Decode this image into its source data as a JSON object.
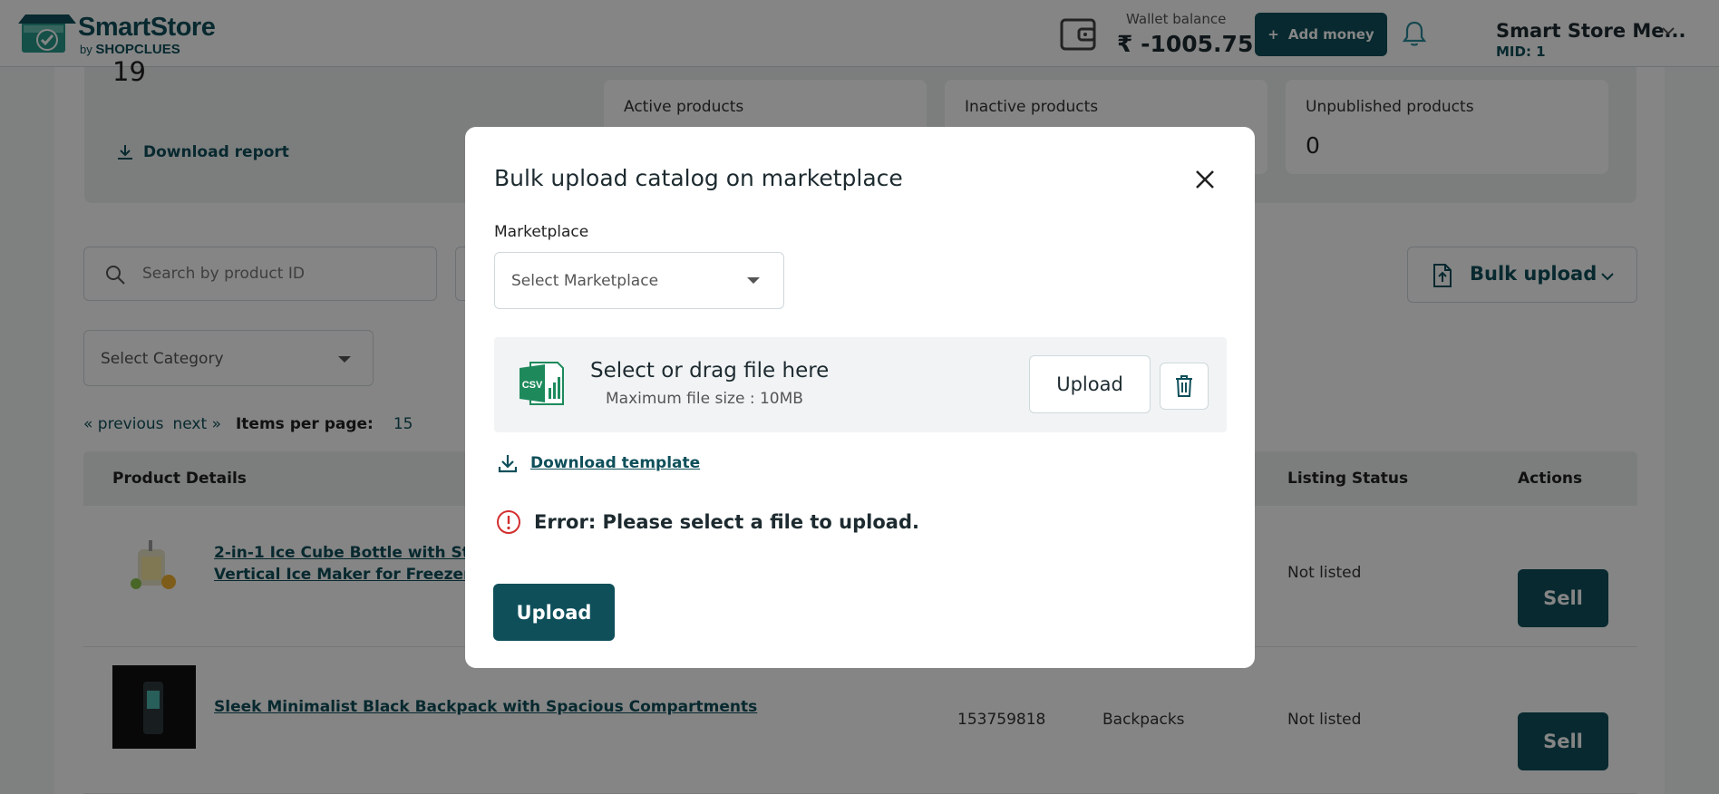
{
  "header": {
    "logo_title": "SmartStore",
    "logo_by": "by",
    "logo_brand": "SHOPCLUES",
    "wallet_label": "Wallet balance",
    "wallet_amount": "₹ -1005.75",
    "add_money_label": "Add money",
    "account_name": "Smart Store Me...",
    "account_mid": "MID: 1"
  },
  "summary": {
    "count_value": "19",
    "download_report_label": "Download report",
    "stats": [
      {
        "label": "Active products",
        "value": ""
      },
      {
        "label": "Inactive products",
        "value": ""
      },
      {
        "label": "Unpublished products",
        "value": "0"
      }
    ]
  },
  "toolbar": {
    "search_placeholder": "Search by product ID",
    "bulk_upload_label": "Bulk upload",
    "category_placeholder": "Select Category"
  },
  "pagination": {
    "previous_label": "« previous",
    "next_label": "next »",
    "items_per_page_label": "Items per page:",
    "items_per_page_value": "15"
  },
  "table": {
    "headers": {
      "product_details": "Product Details",
      "listing_status": "Listing Status",
      "actions": "Actions"
    },
    "rows": [
      {
        "title_line1": "2-in-1 Ice Cube Bottle with Straw",
        "title_line2": "Vertical Ice Maker for Freezer, Tr",
        "product_id": "",
        "category": "",
        "listing_status": "Not listed",
        "action_label": "Sell"
      },
      {
        "title_line1": "Sleek Minimalist Black Backpack with Spacious Compartments",
        "title_line2": "",
        "product_id": "153759818",
        "category": "Backpacks",
        "listing_status": "Not listed",
        "action_label": "Sell"
      }
    ]
  },
  "modal": {
    "title": "Bulk upload catalog on marketplace",
    "marketplace_label": "Marketplace",
    "marketplace_placeholder": "Select Marketplace",
    "dropzone_title": "Select or drag file here",
    "dropzone_subtitle": "Maximum file size : 10MB",
    "dropzone_upload_label": "Upload",
    "csv_badge": "CSV",
    "download_template_label": "Download template",
    "error_message": "Error: Please select a file to upload.",
    "upload_button_label": "Upload"
  },
  "colors": {
    "brand": "#0e4f5a",
    "error": "#d32f2f",
    "csv_green": "#1e8a5c"
  }
}
